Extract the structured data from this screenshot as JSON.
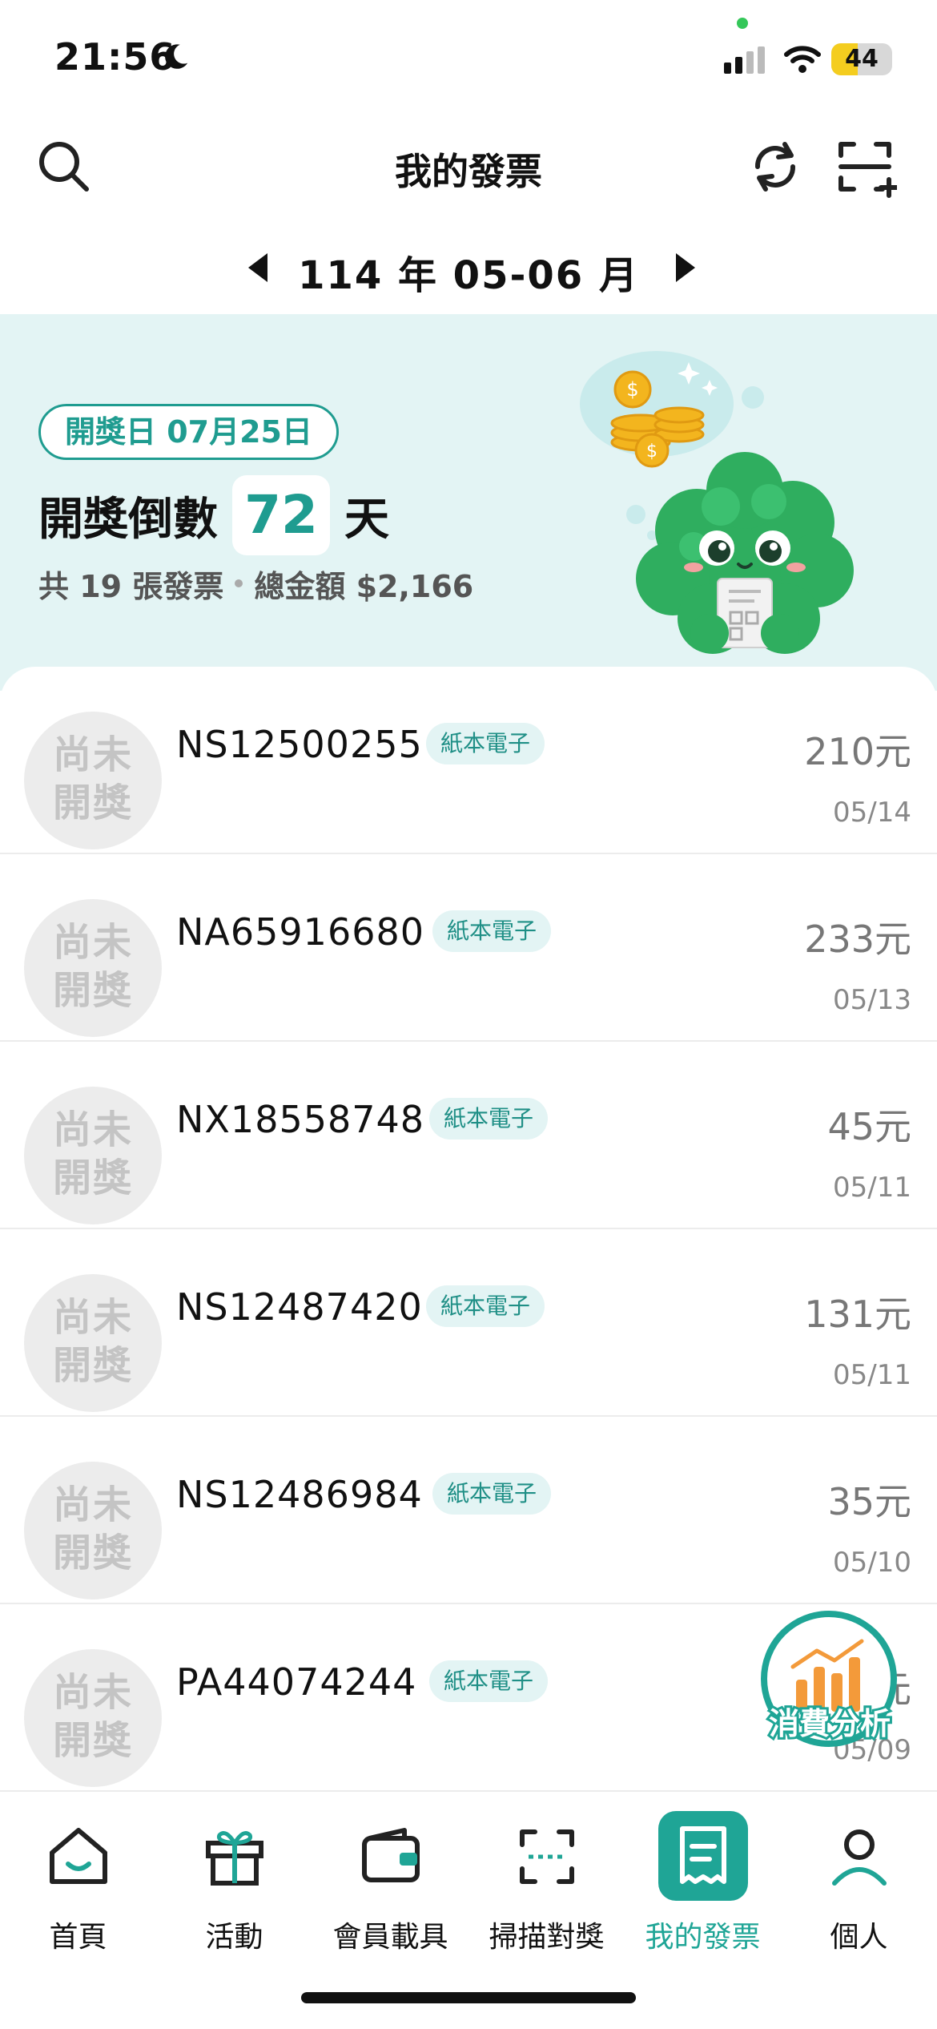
{
  "status_bar": {
    "time": "21:56",
    "battery": "44",
    "battery_level": 0.44
  },
  "header": {
    "title": "我的發票",
    "search_icon": "search-icon",
    "sync_icon": "sync-icon",
    "scan_add_icon": "scan-add-icon"
  },
  "period": {
    "label": "114 年 05-06 月"
  },
  "banner": {
    "draw_date": "開獎日 07月25日",
    "countdown_prefix": "開獎倒數",
    "countdown_days": "72",
    "countdown_suffix": "天",
    "count_text": "共 19 張發票",
    "total_text": "總金額 $2,166"
  },
  "invoices": [
    {
      "status": "尚未開獎",
      "number": "NS12500255",
      "tag": "紙本電子",
      "amount": "210元",
      "date": "05/14"
    },
    {
      "status": "尚未開獎",
      "number": "NA65916680",
      "tag": "紙本電子",
      "amount": "233元",
      "date": "05/13"
    },
    {
      "status": "尚未開獎",
      "number": "NX18558748",
      "tag": "紙本電子",
      "amount": "45元",
      "date": "05/11"
    },
    {
      "status": "尚未開獎",
      "number": "NS12487420",
      "tag": "紙本電子",
      "amount": "131元",
      "date": "05/11"
    },
    {
      "status": "尚未開獎",
      "number": "NS12486984",
      "tag": "紙本電子",
      "amount": "35元",
      "date": "05/10"
    },
    {
      "status": "尚未開獎",
      "number": "PA44074244",
      "tag": "紙本電子",
      "amount": "元",
      "date": "05/09"
    }
  ],
  "fab": {
    "label": "消費分析"
  },
  "tabs": [
    {
      "label": "首頁",
      "icon": "home-icon"
    },
    {
      "label": "活動",
      "icon": "gift-icon"
    },
    {
      "label": "會員載具",
      "icon": "wallet-icon"
    },
    {
      "label": "掃描對獎",
      "icon": "scan-icon"
    },
    {
      "label": "我的發票",
      "icon": "receipt-icon",
      "active": true
    },
    {
      "label": "個人",
      "icon": "person-icon"
    }
  ],
  "colors": {
    "accent": "#1fa596",
    "banner_bg": "#e3f4f4",
    "battery": "#f4cd1f"
  }
}
